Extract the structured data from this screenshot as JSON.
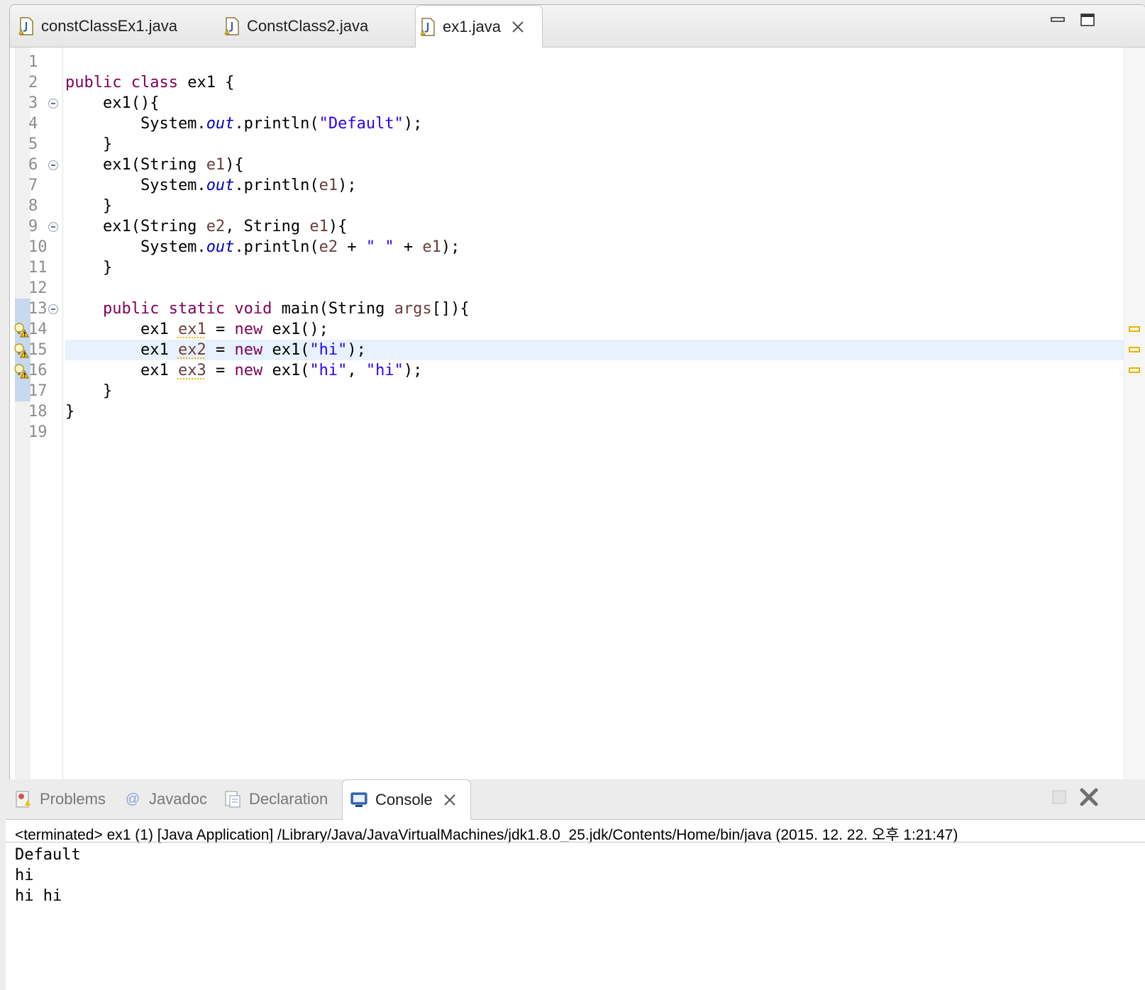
{
  "editor": {
    "tabs": [
      {
        "label": "constClassEx1.java",
        "active": false
      },
      {
        "label": "ConstClass2.java",
        "active": false
      },
      {
        "label": "ex1.java",
        "active": true
      }
    ],
    "minimize_icon": "minimize-icon",
    "maximize_icon": "maximize-icon"
  },
  "code": {
    "highlighted_line": 15,
    "lines": [
      {
        "n": "1",
        "segments": []
      },
      {
        "n": "2",
        "segments": [
          {
            "t": "public class",
            "c": "kw"
          },
          {
            "t": " ex1 {",
            "c": ""
          }
        ]
      },
      {
        "n": "3",
        "fold": true,
        "segments": [
          {
            "t": "    ex1(){",
            "c": ""
          }
        ]
      },
      {
        "n": "4",
        "segments": [
          {
            "t": "        System.",
            "c": ""
          },
          {
            "t": "out",
            "c": "fld"
          },
          {
            "t": ".println(",
            "c": ""
          },
          {
            "t": "\"Default\"",
            "c": "str"
          },
          {
            "t": ");",
            "c": ""
          }
        ]
      },
      {
        "n": "5",
        "segments": [
          {
            "t": "    }",
            "c": ""
          }
        ]
      },
      {
        "n": "6",
        "fold": true,
        "segments": [
          {
            "t": "    ex1(String ",
            "c": ""
          },
          {
            "t": "e1",
            "c": "var"
          },
          {
            "t": "){",
            "c": ""
          }
        ]
      },
      {
        "n": "7",
        "segments": [
          {
            "t": "        System.",
            "c": ""
          },
          {
            "t": "out",
            "c": "fld"
          },
          {
            "t": ".println(",
            "c": ""
          },
          {
            "t": "e1",
            "c": "var"
          },
          {
            "t": ");",
            "c": ""
          }
        ]
      },
      {
        "n": "8",
        "segments": [
          {
            "t": "    }",
            "c": ""
          }
        ]
      },
      {
        "n": "9",
        "fold": true,
        "segments": [
          {
            "t": "    ex1(String ",
            "c": ""
          },
          {
            "t": "e2",
            "c": "var"
          },
          {
            "t": ", String ",
            "c": ""
          },
          {
            "t": "e1",
            "c": "var"
          },
          {
            "t": "){",
            "c": ""
          }
        ]
      },
      {
        "n": "10",
        "segments": [
          {
            "t": "        System.",
            "c": ""
          },
          {
            "t": "out",
            "c": "fld"
          },
          {
            "t": ".println(",
            "c": ""
          },
          {
            "t": "e2",
            "c": "var"
          },
          {
            "t": " + ",
            "c": ""
          },
          {
            "t": "\" \"",
            "c": "str"
          },
          {
            "t": " + ",
            "c": ""
          },
          {
            "t": "e1",
            "c": "var"
          },
          {
            "t": ");",
            "c": ""
          }
        ]
      },
      {
        "n": "11",
        "segments": [
          {
            "t": "    }",
            "c": ""
          }
        ]
      },
      {
        "n": "12",
        "segments": []
      },
      {
        "n": "13",
        "fold": true,
        "sel": true,
        "segments": [
          {
            "t": "    ",
            "c": ""
          },
          {
            "t": "public static void",
            "c": "kw"
          },
          {
            "t": " main(String ",
            "c": ""
          },
          {
            "t": "args",
            "c": "var"
          },
          {
            "t": "[]){",
            "c": ""
          }
        ]
      },
      {
        "n": "14",
        "warn": true,
        "sel": true,
        "segments": [
          {
            "t": "        ex1 ",
            "c": ""
          },
          {
            "t": "ex1",
            "c": "var warnvar"
          },
          {
            "t": " = ",
            "c": ""
          },
          {
            "t": "new",
            "c": "kw"
          },
          {
            "t": " ex1();",
            "c": ""
          }
        ]
      },
      {
        "n": "15",
        "warn": true,
        "sel": true,
        "segments": [
          {
            "t": "        ex1 ",
            "c": ""
          },
          {
            "t": "ex2",
            "c": "var warnvar"
          },
          {
            "t": " = ",
            "c": ""
          },
          {
            "t": "new",
            "c": "kw"
          },
          {
            "t": " ex1(",
            "c": ""
          },
          {
            "t": "\"hi\"",
            "c": "str"
          },
          {
            "t": ");",
            "c": ""
          }
        ]
      },
      {
        "n": "16",
        "warn": true,
        "sel": true,
        "segments": [
          {
            "t": "        ex1 ",
            "c": ""
          },
          {
            "t": "ex3",
            "c": "var warnvar"
          },
          {
            "t": " = ",
            "c": ""
          },
          {
            "t": "new",
            "c": "kw"
          },
          {
            "t": " ex1(",
            "c": ""
          },
          {
            "t": "\"hi\"",
            "c": "str"
          },
          {
            "t": ", ",
            "c": ""
          },
          {
            "t": "\"hi\"",
            "c": "str"
          },
          {
            "t": ");",
            "c": ""
          }
        ]
      },
      {
        "n": "17",
        "sel": true,
        "segments": [
          {
            "t": "    }",
            "c": ""
          }
        ]
      },
      {
        "n": "18",
        "segments": [
          {
            "t": "}",
            "c": ""
          }
        ]
      },
      {
        "n": "19",
        "segments": []
      }
    ]
  },
  "console": {
    "tabs": [
      {
        "label": "Problems",
        "icon": "problems-icon"
      },
      {
        "label": "Javadoc",
        "icon": "javadoc-icon"
      },
      {
        "label": "Declaration",
        "icon": "declaration-icon"
      },
      {
        "label": "Console",
        "icon": "console-icon",
        "active": true
      }
    ],
    "status": "<terminated> ex1 (1) [Java Application] /Library/Java/JavaVirtualMachines/jdk1.8.0_25.jdk/Contents/Home/bin/java (2015. 12. 22. 오후 1:21:47)",
    "output": [
      "Default",
      "hi",
      "hi hi"
    ]
  },
  "colors": {
    "keyword": "#7f0055",
    "string": "#2a00ff",
    "field": "#0000c0",
    "variable": "#6a3e3e",
    "warning": "#e8b400",
    "line_highlight": "#e8f2fe"
  }
}
